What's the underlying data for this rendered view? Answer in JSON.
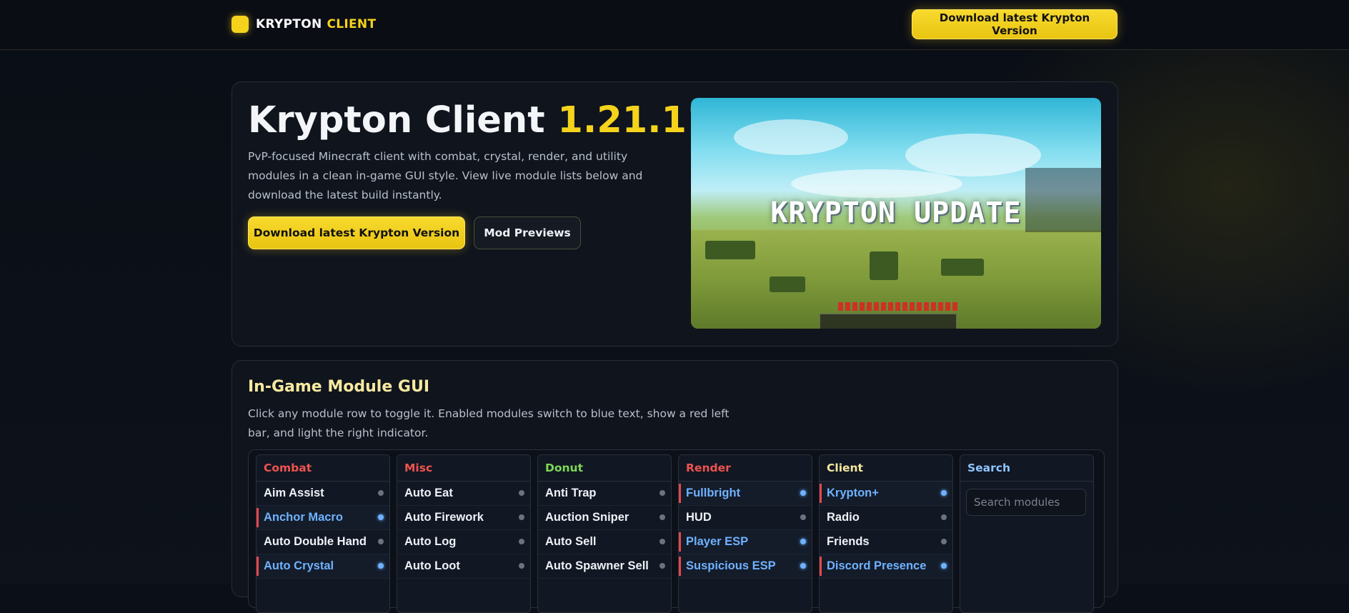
{
  "header": {
    "logo_word1": "KRYPTON",
    "logo_word2": "CLIENT",
    "download_label": "Download latest Krypton Version"
  },
  "hero": {
    "title": "Krypton Client",
    "version": "1.21.11",
    "description": "PvP-focused Minecraft client with combat, crystal, render, and utility modules in a clean in-game GUI style. View live module lists below and download the latest build instantly.",
    "download_label": "Download latest Krypton Version",
    "previews_label": "Mod Previews",
    "screenshot_text": "KRYPTON UPDATE"
  },
  "modules": {
    "title": "In-Game Module GUI",
    "description": "Click any module row to toggle it. Enabled modules switch to blue text, show a red left bar, and light the right indicator.",
    "search_title": "Search",
    "search_placeholder": "Search modules",
    "columns": [
      {
        "name": "Combat",
        "color": "#ef5350",
        "items": [
          {
            "label": "Aim Assist",
            "on": false
          },
          {
            "label": "Anchor Macro",
            "on": true
          },
          {
            "label": "Auto Double Hand",
            "on": false
          },
          {
            "label": "Auto Crystal",
            "on": true
          }
        ]
      },
      {
        "name": "Misc",
        "color": "#ef5350",
        "items": [
          {
            "label": "Auto Eat",
            "on": false
          },
          {
            "label": "Auto Firework",
            "on": false
          },
          {
            "label": "Auto Log",
            "on": false
          },
          {
            "label": "Auto Loot",
            "on": false
          }
        ]
      },
      {
        "name": "Donut",
        "color": "#7ed957",
        "items": [
          {
            "label": "Anti Trap",
            "on": false
          },
          {
            "label": "Auction Sniper",
            "on": false
          },
          {
            "label": "Auto Sell",
            "on": false
          },
          {
            "label": "Auto Spawner Sell",
            "on": false
          }
        ]
      },
      {
        "name": "Render",
        "color": "#ef5350",
        "items": [
          {
            "label": "Fullbright",
            "on": true
          },
          {
            "label": "HUD",
            "on": false
          },
          {
            "label": "Player ESP",
            "on": true
          },
          {
            "label": "Suspicious ESP",
            "on": true
          }
        ]
      },
      {
        "name": "Client",
        "color": "#f7e9a0",
        "items": [
          {
            "label": "Krypton+",
            "on": true
          },
          {
            "label": "Radio",
            "on": false
          },
          {
            "label": "Friends",
            "on": false
          },
          {
            "label": "Discord Presence",
            "on": true
          }
        ]
      }
    ]
  },
  "colors": {
    "accent": "#f5d21c",
    "enabled_text": "#6fb2ff",
    "enabled_bar": "#e5484d",
    "search_title": "#8ec5ff"
  }
}
